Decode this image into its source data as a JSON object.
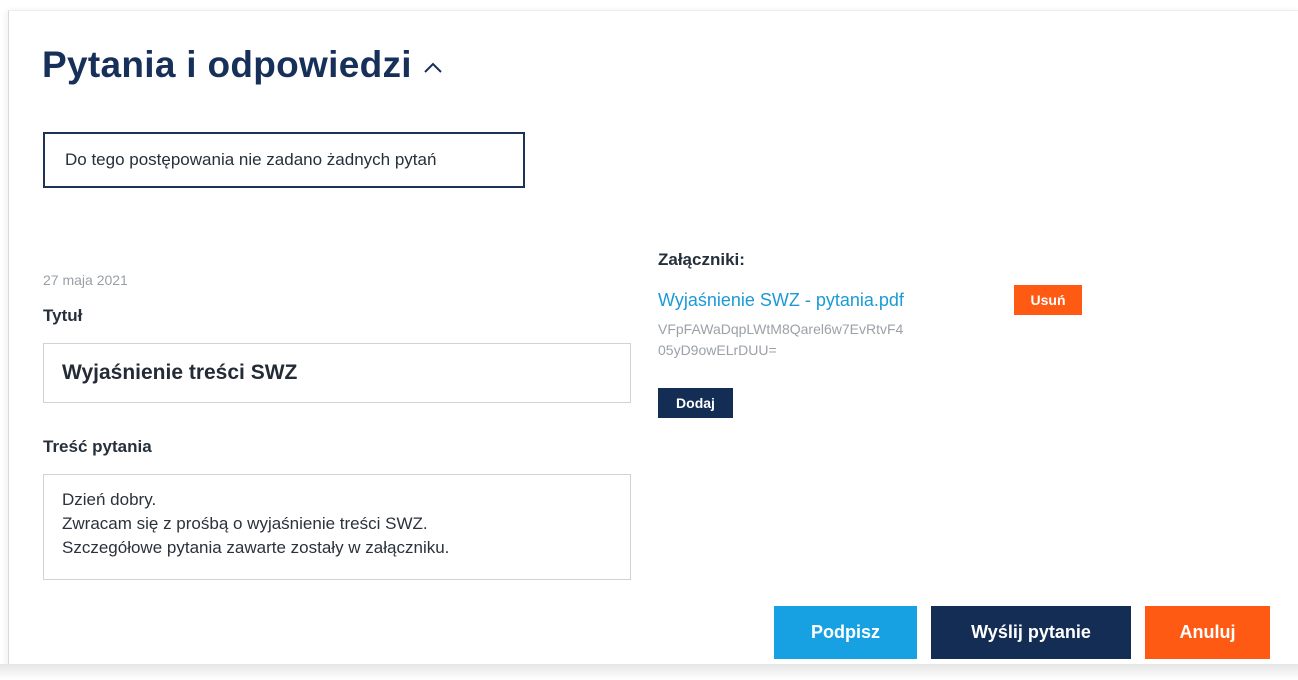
{
  "section": {
    "title": "Pytania i odpowiedzi",
    "toggle_icon": "chevron-up-icon"
  },
  "notice": "Do tego postępowania nie zadano żadnych pytań",
  "question": {
    "date": "27 maja 2021",
    "title_label": "Tytuł",
    "title_value": "Wyjaśnienie treści SWZ",
    "content_label": "Treść pytania",
    "content_lines": [
      "Dzień dobry.",
      "Zwracam się z prośbą o wyjaśnienie treści SWZ.",
      "Szczegółowe pytania zawarte zostały w załączniku."
    ]
  },
  "attachments": {
    "label": "Załączniki:",
    "files": [
      {
        "name": "Wyjaśnienie SWZ - pytania.pdf",
        "hash_lines": [
          "VFpFAWaDqpLWtM8Qarel6w7EvRtvF4",
          "05yD9owELrDUU="
        ],
        "remove_label": "Usuń"
      }
    ],
    "add_label": "Dodaj"
  },
  "actions": {
    "sign_label": "Podpisz",
    "send_label": "Wyślij pytanie",
    "cancel_label": "Anuluj"
  },
  "colors": {
    "navy": "#142d55",
    "blue": "#17a1e3",
    "orange": "#ff5a14",
    "link": "#1b9ad6"
  }
}
